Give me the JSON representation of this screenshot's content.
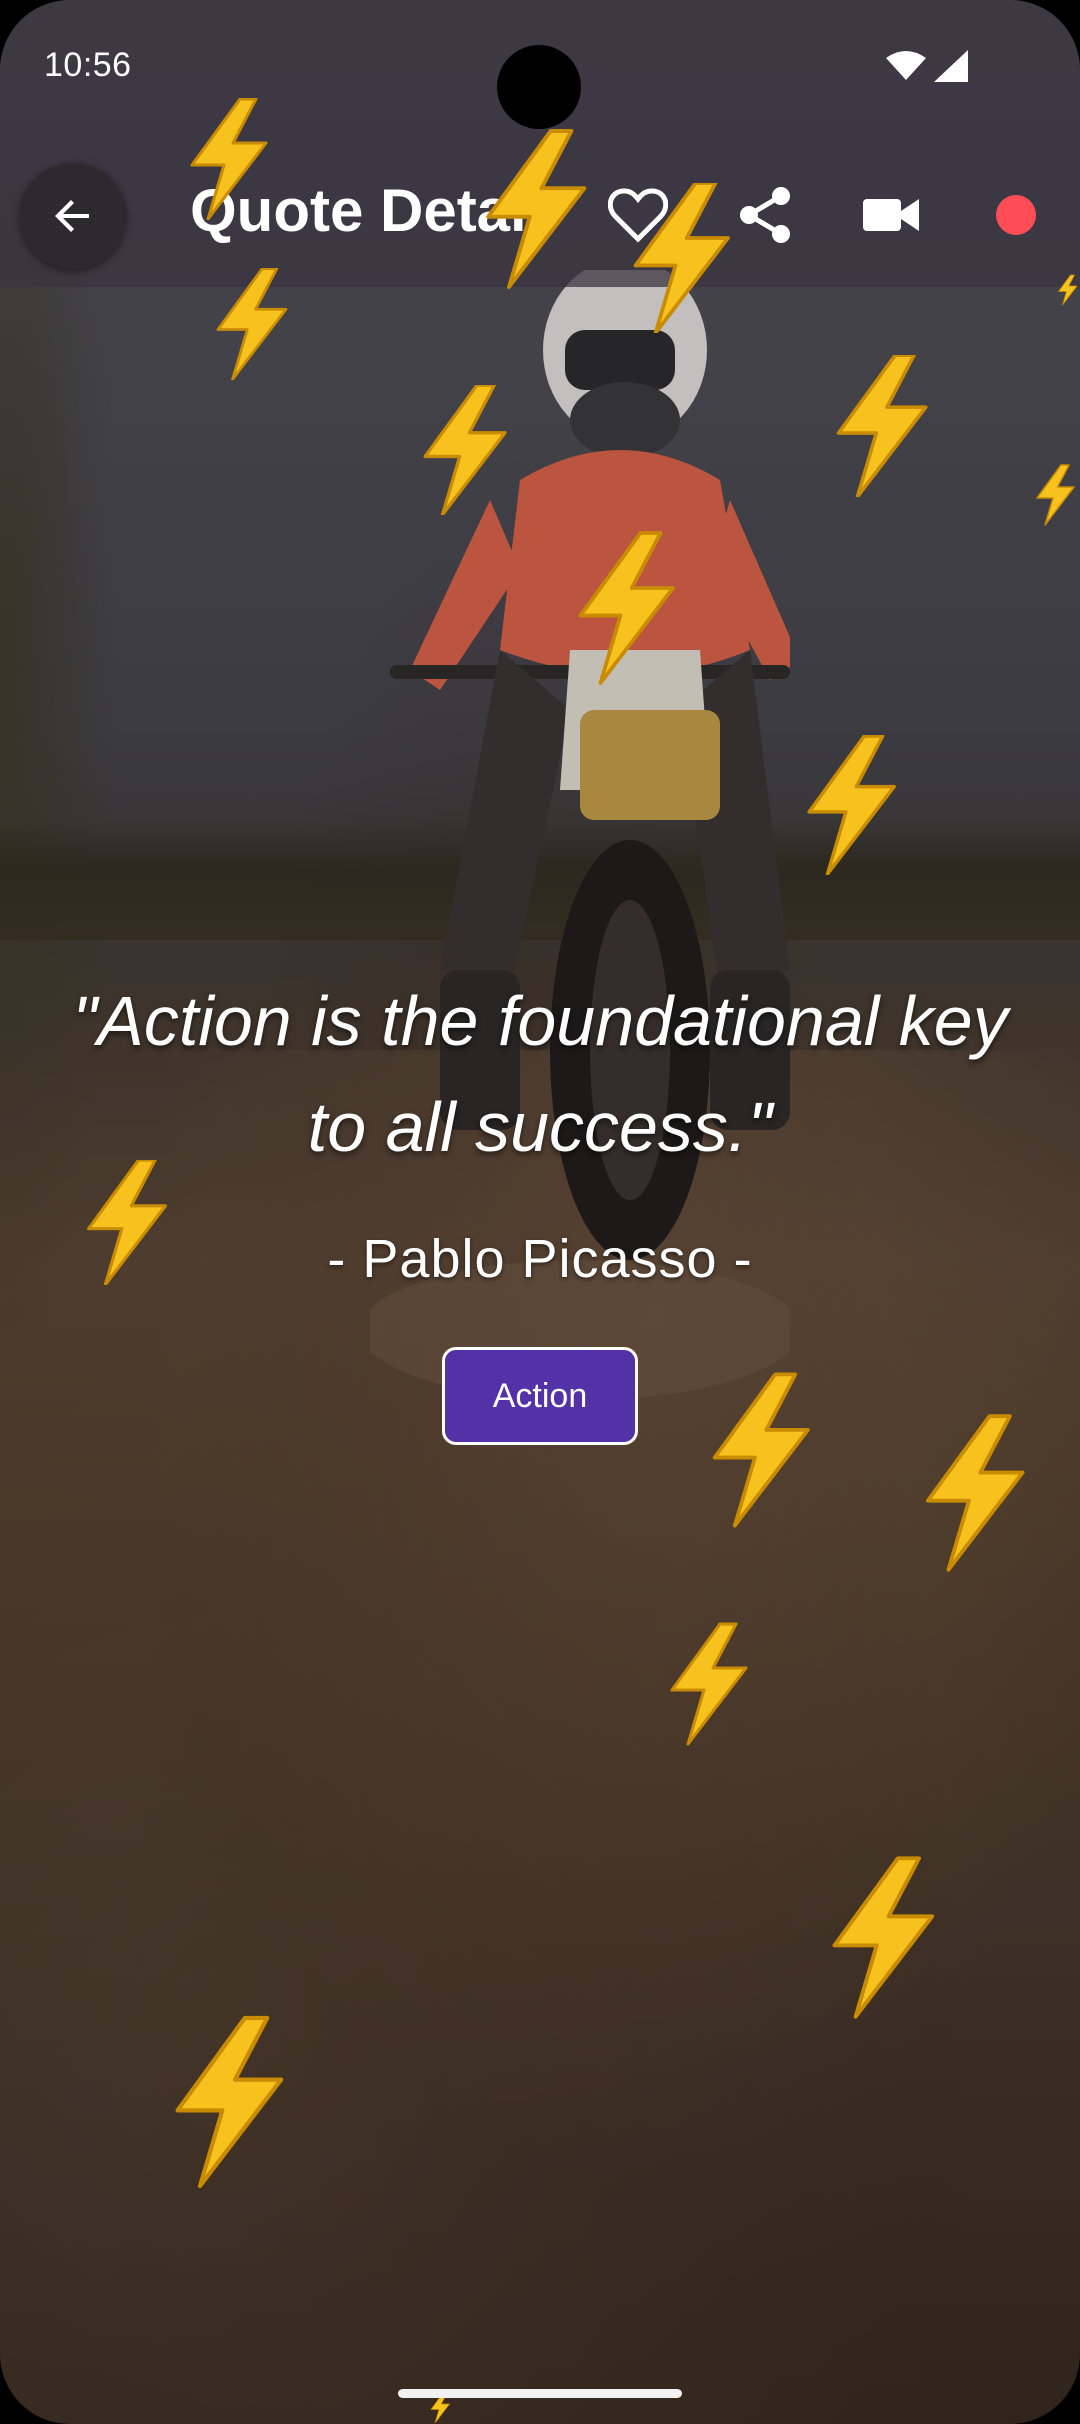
{
  "status_bar": {
    "time": "10:56",
    "icons": [
      "wifi-icon",
      "signal-icon"
    ]
  },
  "app_bar": {
    "title": "Quote Detail",
    "back_icon": "arrow-back-icon",
    "actions": [
      "favorite-outline-icon",
      "share-icon",
      "videocam-icon",
      "record-icon"
    ],
    "record_color": "#ff4d57"
  },
  "quote": {
    "text": "\"Action is the foundational key to all success.\"",
    "author": "- Pablo Picasso -",
    "category_label": "Action",
    "category_color": "#5331a7"
  },
  "overlay": {
    "effect": "lightning-bolt-icon",
    "bolt_color": "#f7c21d"
  }
}
